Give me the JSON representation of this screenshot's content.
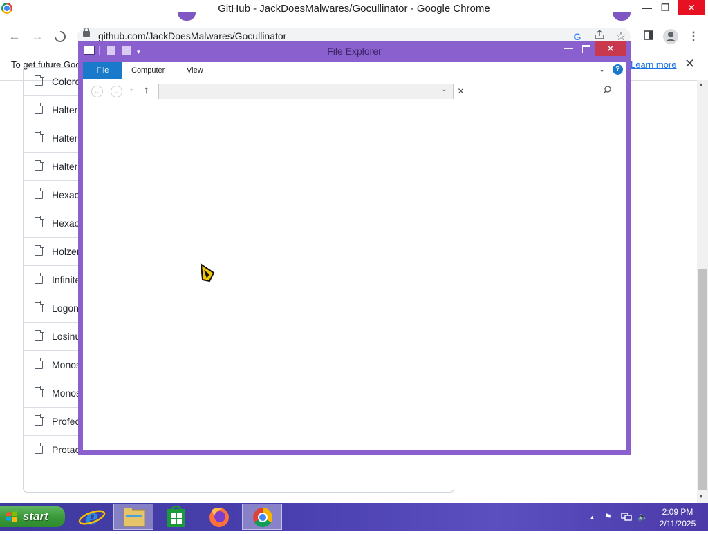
{
  "chrome": {
    "window_title": "GitHub - JackDoesMalwares/Gocullinator - Google Chrome",
    "minimize": "—",
    "restore": "❐",
    "close": "✕",
    "url": "github.com/JackDoesMalwares/Gocullinator",
    "info_bar": {
      "text": "To get future Goo",
      "learn_more": "Learn more",
      "close": "✕"
    }
  },
  "file_list": {
    "items": [
      "Colorc",
      "Halter",
      "Halter",
      "Halter",
      "Hexac",
      "Hexac",
      "Holzer",
      "Infinite",
      "Logon",
      "Losinu",
      "Monos",
      "Monos",
      "Profec",
      "Protac"
    ]
  },
  "file_explorer": {
    "title": "File Explorer",
    "tabs": {
      "file": "File",
      "computer": "Computer",
      "view": "View"
    },
    "address_value": "",
    "search_value": "",
    "help": "?"
  },
  "taskbar": {
    "start": "start",
    "pinned": [
      "internet-explorer",
      "file-explorer",
      "store",
      "firefox",
      "chrome"
    ],
    "time": "2:09 PM",
    "date": "2/11/2025"
  },
  "colors": {
    "fe_frame": "#8a5fce",
    "fe_file_tab": "#1979ca",
    "chrome_close": "#e81123",
    "start_green": "#3a9a3a",
    "taskbar": "#4a3fae"
  }
}
